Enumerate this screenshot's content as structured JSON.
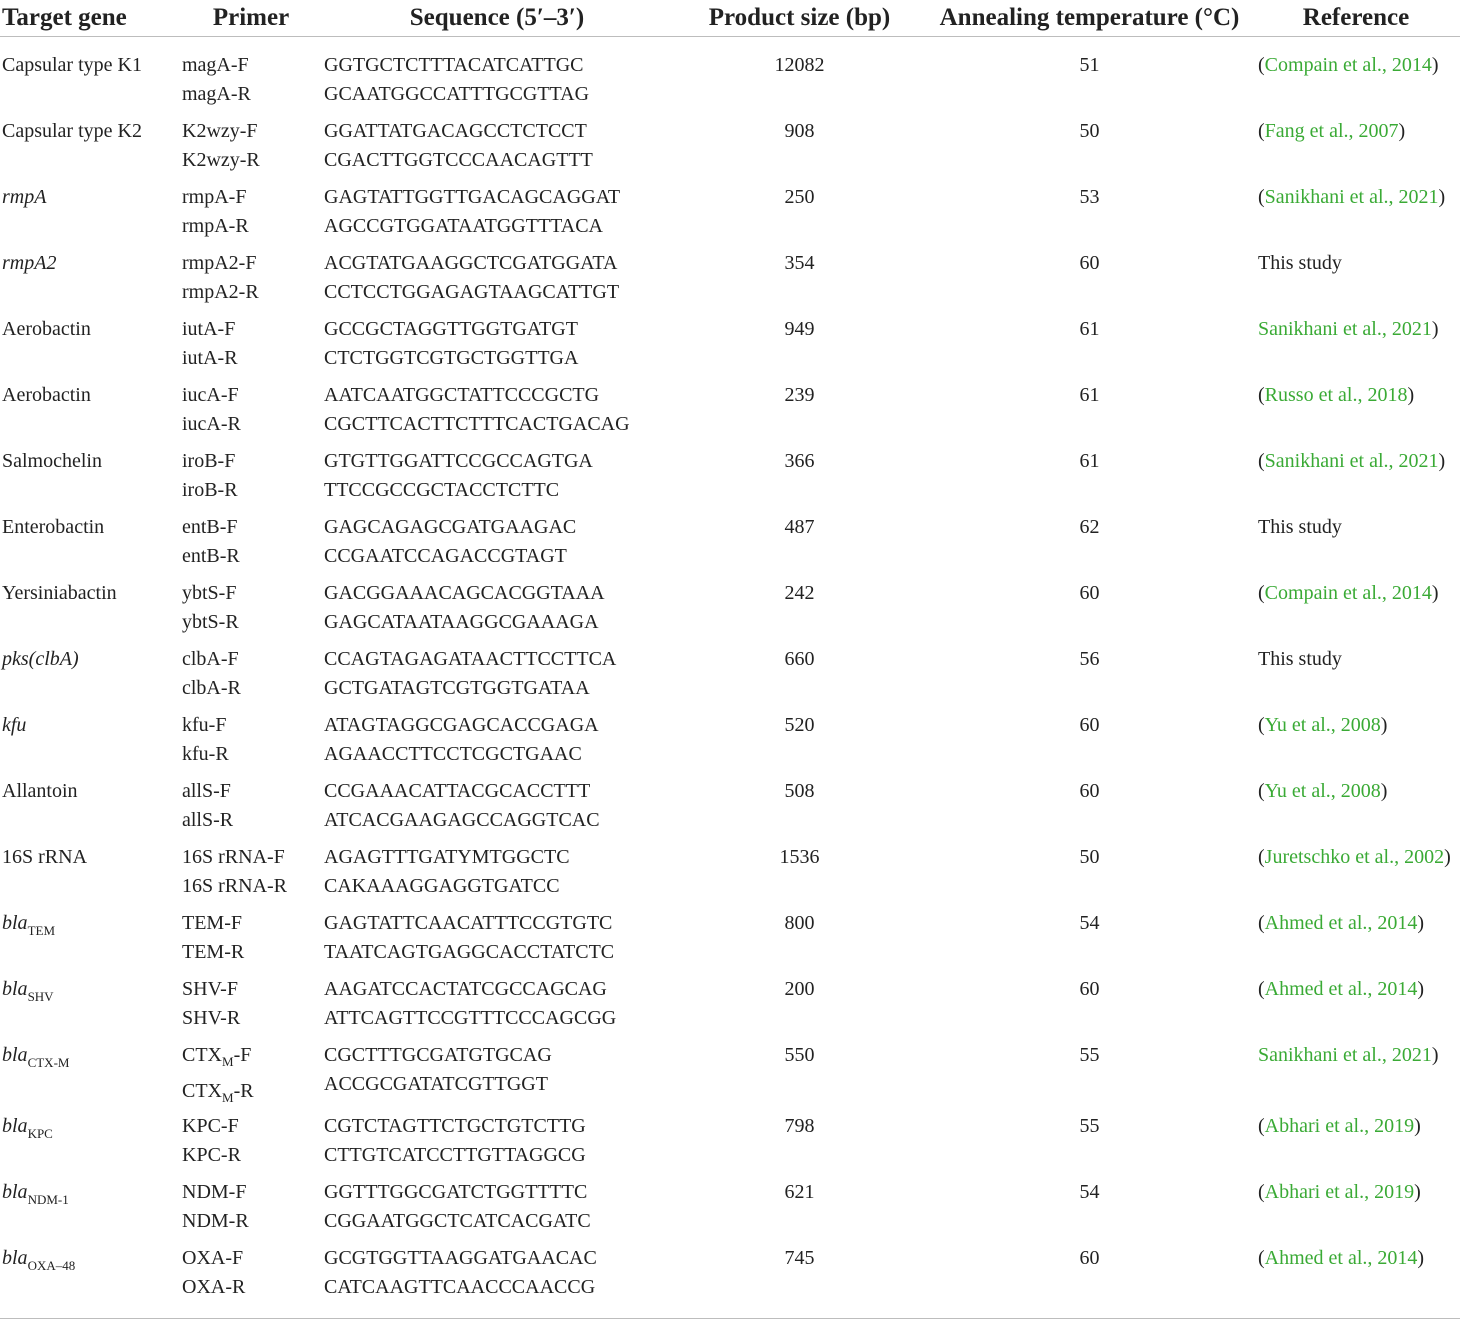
{
  "table": {
    "headers": {
      "target_gene": "Target gene",
      "primer": "Primer",
      "sequence": "Sequence (5′–3′)",
      "product_size": "Product size (bp)",
      "annealing_temperature": "Annealing temperature (°C)",
      "reference": "Reference"
    },
    "rows": [
      {
        "gene": "Capsular type K1",
        "primer_f": "magA-F",
        "primer_r": "magA-R",
        "seq_f": "GGTGCTCTTTACATCATTGC",
        "seq_r": "GCAATGGCCATTTGCGTTAG",
        "size": "12082",
        "temp": "51",
        "ref_open": "(",
        "ref_text": "Compain et al., 2014",
        "ref_close": ")"
      },
      {
        "gene": "Capsular type K2",
        "primer_f": "K2wzy-F",
        "primer_r": "K2wzy-R",
        "seq_f": "GGATTATGACAGCCTCTCCT",
        "seq_r": "CGACTTGGTCCCAACAGTTT",
        "size": "908",
        "temp": "50",
        "ref_open": "(",
        "ref_text": "Fang et al., 2007",
        "ref_close": ")"
      },
      {
        "gene": "rmpA",
        "primer_f": "rmpA-F",
        "primer_r": "rmpA-R",
        "seq_f": "GAGTATTGGTTGACAGCAGGAT",
        "seq_r": "AGCCGTGGATAATGGTTTACA",
        "size": "250",
        "temp": "53",
        "ref_open": "(",
        "ref_text": "Sanikhani et al., 2021",
        "ref_close": ")"
      },
      {
        "gene": "rmpA2",
        "primer_f": "rmpA2-F",
        "primer_r": "rmpA2-R",
        "seq_f": "ACGTATGAAGGCTCGATGGATA",
        "seq_r": "CCTCCTGGAGAGTAAGCATTGT",
        "size": "354",
        "temp": "60",
        "ref_plain": "This study"
      },
      {
        "gene": "Aerobactin",
        "primer_f": "iutA-F",
        "primer_r": "iutA-R",
        "seq_f": "GCCGCTAGGTTGGTGATGT",
        "seq_r": "CTCTGGTCGTGCTGGTTGA",
        "size": "949",
        "temp": "61",
        "ref_open": "",
        "ref_text": "Sanikhani et al., 2021",
        "ref_close": ")"
      },
      {
        "gene": "Aerobactin",
        "primer_f": "iucA-F",
        "primer_r": "iucA-R",
        "seq_f": "AATCAATGGCTATTCCCGCTG",
        "seq_r": "CGCTTCACTTCTTTCACTGACAG",
        "size": "239",
        "temp": "61",
        "ref_open": "(",
        "ref_text": "Russo et al., 2018",
        "ref_close": ")"
      },
      {
        "gene": "Salmochelin",
        "primer_f": "iroB-F",
        "primer_r": "iroB-R",
        "seq_f": "GTGTTGGATTCCGCCAGTGA",
        "seq_r": "TTCCGCCGCTACCTCTTC",
        "size": "366",
        "temp": "61",
        "ref_open": "(",
        "ref_text": "Sanikhani et al., 2021",
        "ref_close": ")"
      },
      {
        "gene": "Enterobactin",
        "primer_f": "entB-F",
        "primer_r": "entB-R",
        "seq_f": "GAGCAGAGCGATGAAGAC",
        "seq_r": "CCGAATCCAGACCGTAGT",
        "size": "487",
        "temp": "62",
        "ref_plain": "This study"
      },
      {
        "gene": "Yersiniabactin",
        "primer_f": "ybtS-F",
        "primer_r": "ybtS-R",
        "seq_f": "GACGGAAACAGCACGGTAAA",
        "seq_r": "GAGCATAATAAGGCGAAAGA",
        "size": "242",
        "temp": "60",
        "ref_open": "(",
        "ref_text": "Compain et al., 2014",
        "ref_close": ")"
      },
      {
        "gene": "pks(clbA)",
        "primer_f": "clbA-F",
        "primer_r": "clbA-R",
        "seq_f": "CCAGTAGAGATAACTTCCTTCA",
        "seq_r": "GCTGATAGTCGTGGTGATAA",
        "size": "660",
        "temp": "56",
        "ref_plain": "This study"
      },
      {
        "gene": "kfu",
        "primer_f": "kfu-F",
        "primer_r": "kfu-R",
        "seq_f": "ATAGTAGGCGAGCACCGAGA",
        "seq_r": "AGAACCTTCCTCGCTGAAC",
        "size": "520",
        "temp": "60",
        "ref_open": "(",
        "ref_text": "Yu et al., 2008",
        "ref_close": ")"
      },
      {
        "gene": "Allantoin",
        "primer_f": "allS-F",
        "primer_r": "allS-R",
        "seq_f": "CCGAAACATTACGCACCTTT",
        "seq_r": "ATCACGAAGAGCCAGGTCAC",
        "size": "508",
        "temp": "60",
        "ref_open": "(",
        "ref_text": "Yu et al., 2008",
        "ref_close": ")"
      },
      {
        "gene": "16S rRNA",
        "primer_f": "16S rRNA-F",
        "primer_r": "16S rRNA-R",
        "seq_f": "AGAGTTTGATYMTGGCTC",
        "seq_r": "CAKAAAGGAGGTGATCC",
        "size": "1536",
        "temp": "50",
        "ref_open": "(",
        "ref_text": "Juretschko et al., 2002",
        "ref_close": ")"
      },
      {
        "gene": "bla",
        "gene_sub": "TEM",
        "primer_f": "TEM-F",
        "primer_r": "TEM-R",
        "seq_f": "GAGTATTCAACATTTCCGTGTC",
        "seq_r": "TAATCAGTGAGGCACCTATCTC",
        "size": "800",
        "temp": "54",
        "ref_open": "(",
        "ref_text": "Ahmed et al., 2014",
        "ref_close": ")"
      },
      {
        "gene": "bla",
        "gene_sub": "SHV",
        "primer_f": "SHV-F",
        "primer_r": "SHV-R",
        "seq_f": "AAGATCCACTATCGCCAGCAG",
        "seq_r": "ATTCAGTTCCGTTTCCCAGCGG",
        "size": "200",
        "temp": "60",
        "ref_open": "(",
        "ref_text": "Ahmed et al., 2014",
        "ref_close": ")"
      },
      {
        "gene": "bla",
        "gene_sub": "CTX-M",
        "primer_f_pre": "CTX",
        "primer_f_sub": "M",
        "primer_f_post": "-F",
        "primer_r_pre": "CTX",
        "primer_r_sub": "M",
        "primer_r_post": "-R",
        "seq_f": "CGCTTTGCGATGTGCAG",
        "seq_r": "ACCGCGATATCGTTGGT",
        "size": "550",
        "temp": "55",
        "ref_open": "",
        "ref_text": "Sanikhani et al., 2021",
        "ref_close": ")"
      },
      {
        "gene": "bla",
        "gene_sub": "KPC",
        "primer_f": "KPC-F",
        "primer_r": "KPC-R",
        "seq_f": "CGTCTAGTTCTGCTGTCTTG",
        "seq_r": "CTTGTCATCCTTGTTAGGCG",
        "size": "798",
        "temp": "55",
        "ref_open": "(",
        "ref_text": "Abhari et al., 2019",
        "ref_close": ")"
      },
      {
        "gene": "bla",
        "gene_sub": "NDM-1",
        "primer_f": "NDM-F",
        "primer_r": "NDM-R",
        "seq_f": "GGTTTGGCGATCTGGTTTTC",
        "seq_r": "CGGAATGGCTCATCACGATC",
        "size": "621",
        "temp": "54",
        "ref_open": "(",
        "ref_text": "Abhari et al., 2019",
        "ref_close": ")"
      },
      {
        "gene": "bla",
        "gene_sub": "OXA–48",
        "primer_f": "OXA-F",
        "primer_r": "OXA-R",
        "seq_f": "GCGTGGTTAAGGATGAACAC",
        "seq_r": "CATCAAGTTCAACCCAACCG",
        "size": "745",
        "temp": "60",
        "ref_open": "(",
        "ref_text": "Ahmed et al., 2014",
        "ref_close": ")"
      }
    ]
  },
  "colors": {
    "text": "#222222",
    "link": "#3aaa35",
    "rule": "#bdbdbd"
  }
}
